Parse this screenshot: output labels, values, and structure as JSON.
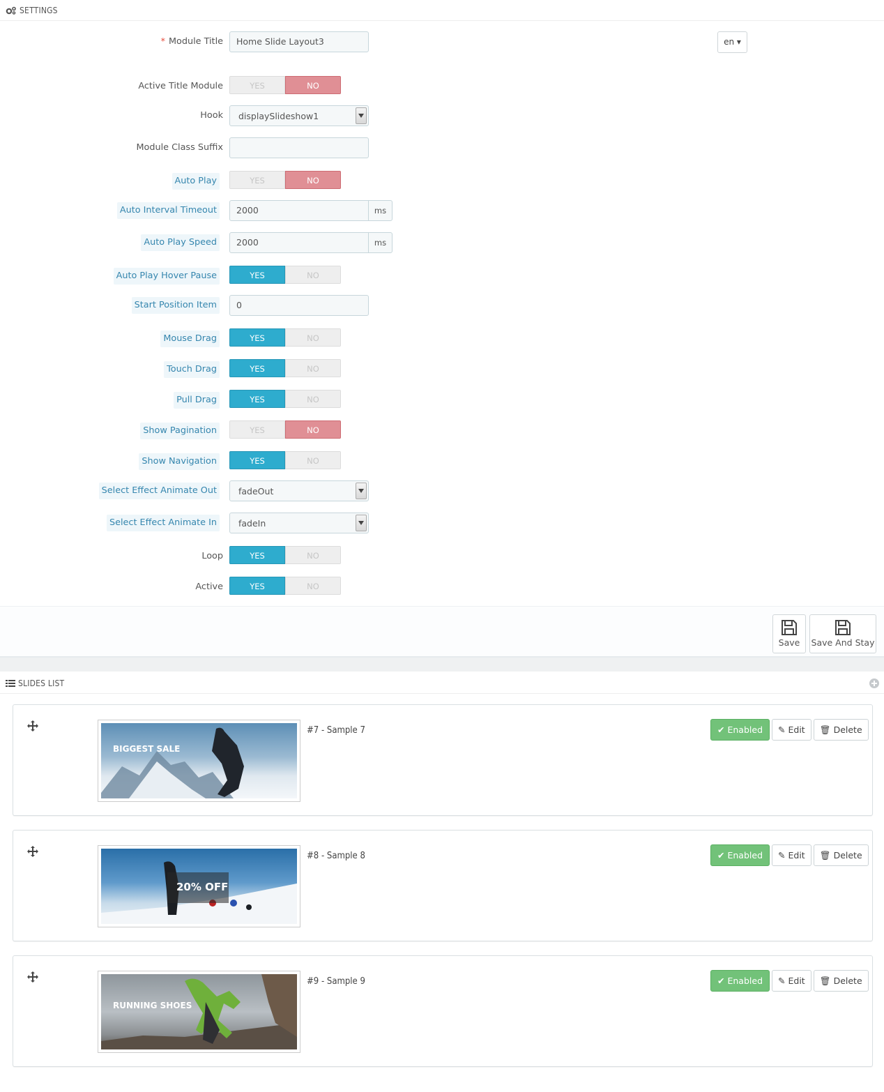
{
  "settings": {
    "header": "SETTINGS",
    "lang": "en",
    "fields": {
      "module_title": {
        "label": "Module Title",
        "value": "Home Slide Layout3"
      },
      "active_title": {
        "label": "Active Title Module",
        "yes": "YES",
        "no": "NO",
        "value": "NO"
      },
      "hook": {
        "label": "Hook",
        "value": "displaySlideshow1"
      },
      "class_suffix": {
        "label": "Module Class Suffix",
        "value": ""
      },
      "auto_play": {
        "label": "Auto Play",
        "yes": "YES",
        "no": "NO",
        "value": "NO"
      },
      "auto_interval": {
        "label": "Auto Interval Timeout",
        "value": "2000",
        "unit": "ms"
      },
      "auto_speed": {
        "label": "Auto Play Speed",
        "value": "2000",
        "unit": "ms"
      },
      "hover_pause": {
        "label": "Auto Play Hover Pause",
        "yes": "YES",
        "no": "NO",
        "value": "YES"
      },
      "start_position": {
        "label": "Start Position Item",
        "value": "0"
      },
      "mouse_drag": {
        "label": "Mouse Drag",
        "yes": "YES",
        "no": "NO",
        "value": "YES"
      },
      "touch_drag": {
        "label": "Touch Drag",
        "yes": "YES",
        "no": "NO",
        "value": "YES"
      },
      "pull_drag": {
        "label": "Pull Drag",
        "yes": "YES",
        "no": "NO",
        "value": "YES"
      },
      "pagination": {
        "label": "Show Pagination",
        "yes": "YES",
        "no": "NO",
        "value": "NO"
      },
      "navigation": {
        "label": "Show Navigation",
        "yes": "YES",
        "no": "NO",
        "value": "YES"
      },
      "animate_out": {
        "label": "Select Effect Animate Out",
        "value": "fadeOut"
      },
      "animate_in": {
        "label": "Select Effect Animate In",
        "value": "fadeIn"
      },
      "loop": {
        "label": "Loop",
        "yes": "YES",
        "no": "NO",
        "value": "YES"
      },
      "active": {
        "label": "Active",
        "yes": "YES",
        "no": "NO",
        "value": "YES"
      }
    },
    "save_label": "Save",
    "save_stay_label": "Save And Stay"
  },
  "slides_list": {
    "header": "SLIDES LIST",
    "enabled_label": "Enabled",
    "edit_label": "Edit",
    "delete_label": "Delete",
    "items": [
      {
        "title": "#7 - Sample 7",
        "image_text": "BIGGEST SALE"
      },
      {
        "title": "#8 - Sample 8",
        "image_text": "20% OFF"
      },
      {
        "title": "#9 - Sample 9",
        "image_text": "RUNNING SHOES"
      }
    ]
  }
}
